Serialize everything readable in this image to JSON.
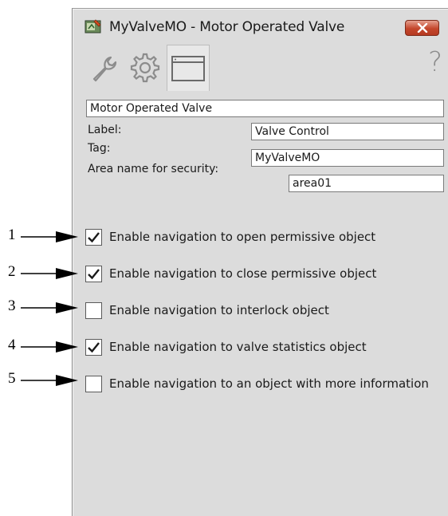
{
  "window": {
    "title": "MyValveMO - Motor Operated Valve",
    "close_icon": "close-icon"
  },
  "toolbar": {
    "tabs": [
      {
        "icon": "wrench-icon"
      },
      {
        "icon": "gear-icon"
      },
      {
        "icon": "window-icon",
        "active": true
      }
    ],
    "help_label": "?"
  },
  "form": {
    "description": "Motor Operated Valve",
    "label_caption": "Label:",
    "label_value": "Valve Control",
    "tag_caption": "Tag:",
    "tag_value": "MyValveMO",
    "area_caption": "Area name for security:",
    "area_value": "area01"
  },
  "navigation_options": [
    {
      "label": "Enable navigation to open permissive object",
      "checked": true,
      "callout": "1"
    },
    {
      "label": "Enable navigation to close permissive object",
      "checked": true,
      "callout": "2"
    },
    {
      "label": "Enable navigation to interlock object",
      "checked": false,
      "callout": "3"
    },
    {
      "label": "Enable navigation to valve statistics object",
      "checked": true,
      "callout": "4"
    },
    {
      "label": "Enable navigation to an object with more information",
      "checked": false,
      "callout": "5"
    }
  ]
}
